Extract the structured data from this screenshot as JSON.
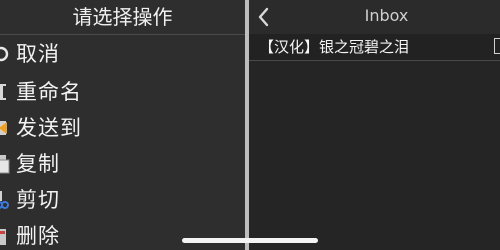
{
  "menu": {
    "title": "请选择操作",
    "items": [
      {
        "label": "取消",
        "icon": "cancel-circle-icon"
      },
      {
        "label": "重命名",
        "icon": "rename-icon"
      },
      {
        "label": "发送到",
        "icon": "send-to-icon"
      },
      {
        "label": "复制",
        "icon": "copy-icon"
      },
      {
        "label": "剪切",
        "icon": "scissors-icon"
      },
      {
        "label": "删除",
        "icon": "delete-icon"
      }
    ]
  },
  "inbox": {
    "title": "Inbox",
    "back_icon": "chevron-left-icon",
    "files": [
      {
        "name": "【汉化】银之冠碧之泪"
      }
    ]
  },
  "colors": {
    "menu_bg": "#2e2e2e",
    "inbox_bg": "#252525",
    "divider": "#bdbdbd",
    "text": "#f2f2f2"
  }
}
